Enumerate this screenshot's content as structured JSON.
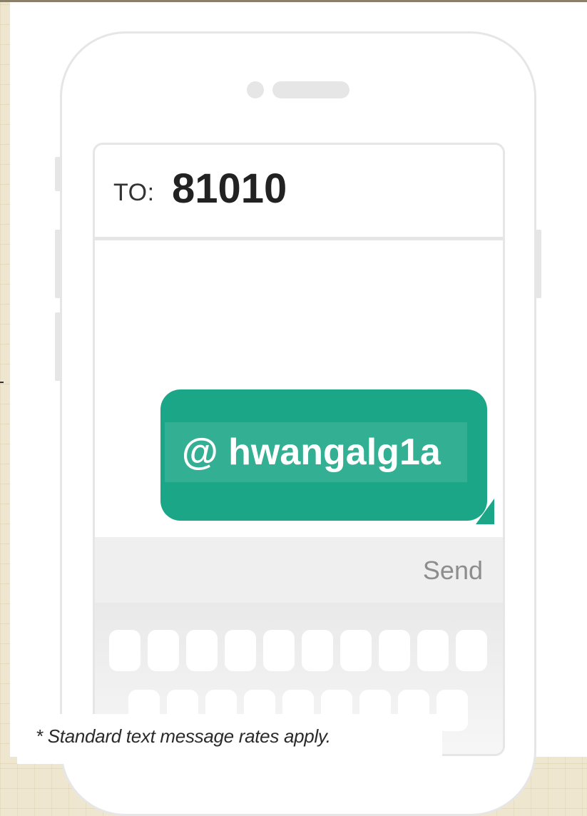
{
  "recipient": {
    "label": "TO:",
    "number": "81010"
  },
  "message": {
    "text": "@ hwangalg1a",
    "bubble_color": "#1ca688"
  },
  "compose": {
    "send_label": "Send"
  },
  "footer": {
    "disclaimer": "* Standard text message rates apply."
  },
  "icons": [
    "speaker-icon",
    "phone-outline-icon"
  ]
}
